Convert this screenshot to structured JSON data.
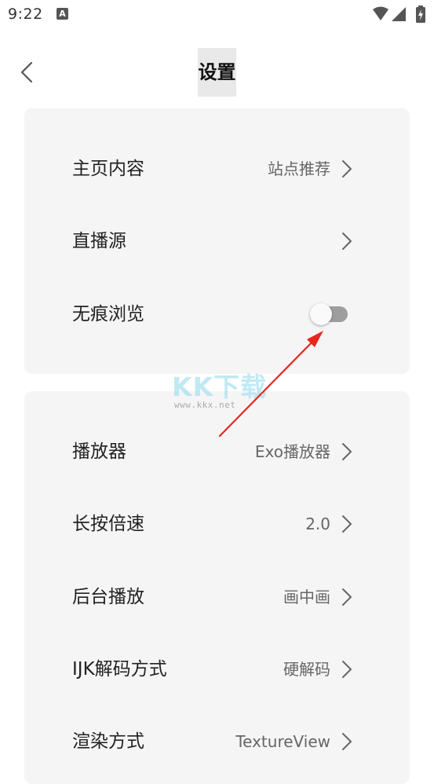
{
  "status_bar": {
    "time": "9:22",
    "notification_icon": "a-letter-icon",
    "wifi_icon": "wifi-icon",
    "signal_icon": "signal-icon",
    "battery_icon": "battery-charging-icon"
  },
  "header": {
    "back_icon": "chevron-left-icon",
    "title": "设置"
  },
  "section_1": {
    "rows": [
      {
        "label": "主页内容",
        "value": "站点推荐",
        "type": "nav"
      },
      {
        "label": "直播源",
        "value": "",
        "type": "nav"
      },
      {
        "label": "无痕浏览",
        "type": "toggle",
        "on": false
      }
    ]
  },
  "section_2": {
    "rows": [
      {
        "label": "播放器",
        "value": "Exo播放器",
        "type": "nav"
      },
      {
        "label": "长按倍速",
        "value": "2.0",
        "type": "nav"
      },
      {
        "label": "后台播放",
        "value": "画中画",
        "type": "nav"
      },
      {
        "label": "IJK解码方式",
        "value": "硬解码",
        "type": "nav"
      },
      {
        "label": "渲染方式",
        "value": "TextureView",
        "type": "nav"
      }
    ]
  },
  "watermark": {
    "logo": "KK下载",
    "url": "www.kkx.net"
  },
  "colors": {
    "card_background": "#f5f5f5",
    "toggle_off_track": "#9e9e9e",
    "annotation_arrow": "#e8261c"
  }
}
